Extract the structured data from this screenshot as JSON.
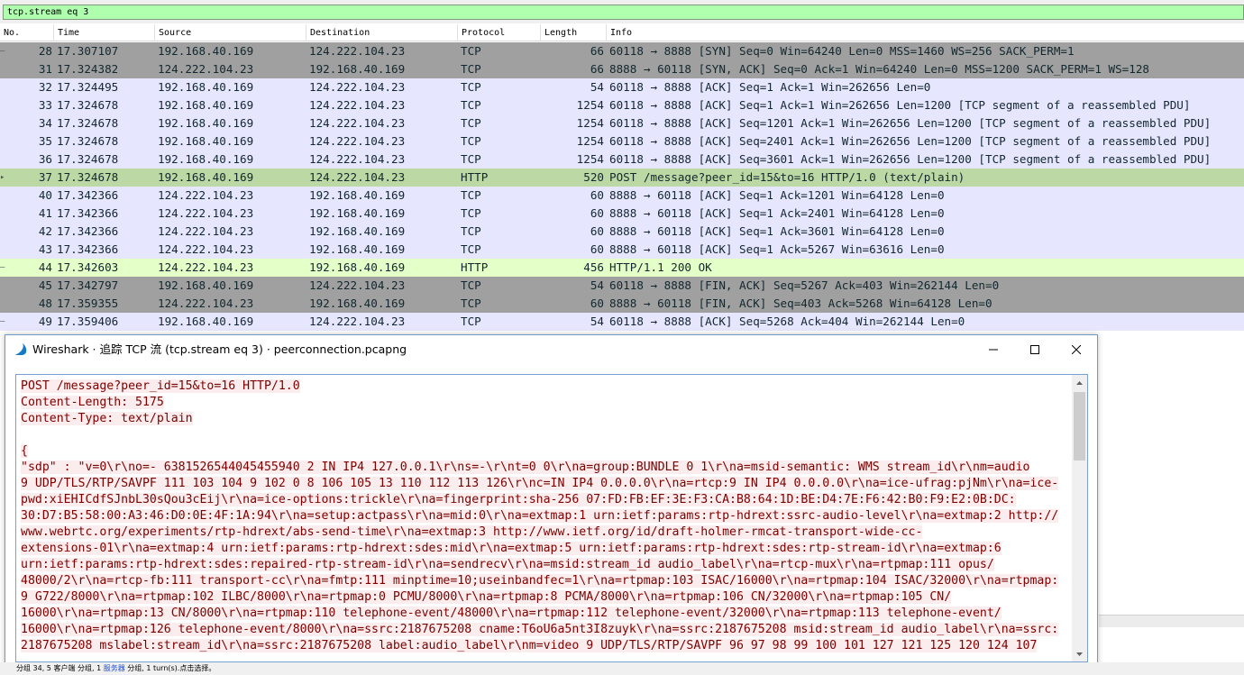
{
  "filter": {
    "text": "tcp.stream eq 3"
  },
  "columns": [
    "No.",
    "Time",
    "Source",
    "Destination",
    "Protocol",
    "Length",
    "Info"
  ],
  "packets": [
    {
      "no": "28",
      "time": "17.307107",
      "src": "192.168.40.169",
      "dst": "124.222.104.23",
      "proto": "TCP",
      "len": "66",
      "info": "60118 → 8888 [SYN] Seq=0 Win=64240 Len=0 MSS=1460 WS=256 SACK_PERM=1",
      "bg": "#a0a0a0",
      "mark": "–"
    },
    {
      "no": "31",
      "time": "17.324382",
      "src": "124.222.104.23",
      "dst": "192.168.40.169",
      "proto": "TCP",
      "len": "66",
      "info": "8888 → 60118 [SYN, ACK] Seq=0 Ack=1 Win=64240 Len=0 MSS=1200 SACK_PERM=1 WS=128",
      "bg": "#a0a0a0",
      "mark": ""
    },
    {
      "no": "32",
      "time": "17.324495",
      "src": "192.168.40.169",
      "dst": "124.222.104.23",
      "proto": "TCP",
      "len": "54",
      "info": "60118 → 8888 [ACK] Seq=1 Ack=1 Win=262656 Len=0",
      "bg": "#e7e6ff",
      "mark": ""
    },
    {
      "no": "33",
      "time": "17.324678",
      "src": "192.168.40.169",
      "dst": "124.222.104.23",
      "proto": "TCP",
      "len": "1254",
      "info": "60118 → 8888 [ACK] Seq=1 Ack=1 Win=262656 Len=1200 [TCP segment of a reassembled PDU]",
      "bg": "#e7e6ff",
      "mark": ""
    },
    {
      "no": "34",
      "time": "17.324678",
      "src": "192.168.40.169",
      "dst": "124.222.104.23",
      "proto": "TCP",
      "len": "1254",
      "info": "60118 → 8888 [ACK] Seq=1201 Ack=1 Win=262656 Len=1200 [TCP segment of a reassembled PDU]",
      "bg": "#e7e6ff",
      "mark": ""
    },
    {
      "no": "35",
      "time": "17.324678",
      "src": "192.168.40.169",
      "dst": "124.222.104.23",
      "proto": "TCP",
      "len": "1254",
      "info": "60118 → 8888 [ACK] Seq=2401 Ack=1 Win=262656 Len=1200 [TCP segment of a reassembled PDU]",
      "bg": "#e7e6ff",
      "mark": ""
    },
    {
      "no": "36",
      "time": "17.324678",
      "src": "192.168.40.169",
      "dst": "124.222.104.23",
      "proto": "TCP",
      "len": "1254",
      "info": "60118 → 8888 [ACK] Seq=3601 Ack=1 Win=262656 Len=1200 [TCP segment of a reassembled PDU]",
      "bg": "#e7e6ff",
      "mark": ""
    },
    {
      "no": "37",
      "time": "17.324678",
      "src": "192.168.40.169",
      "dst": "124.222.104.23",
      "proto": "HTTP",
      "len": "520",
      "info": "POST /message?peer_id=15&to=16 HTTP/1.0  (text/plain)",
      "bg": "#bcd8a4",
      "mark": "▸"
    },
    {
      "no": "40",
      "time": "17.342366",
      "src": "124.222.104.23",
      "dst": "192.168.40.169",
      "proto": "TCP",
      "len": "60",
      "info": "8888 → 60118 [ACK] Seq=1 Ack=1201 Win=64128 Len=0",
      "bg": "#e7e6ff",
      "mark": ""
    },
    {
      "no": "41",
      "time": "17.342366",
      "src": "124.222.104.23",
      "dst": "192.168.40.169",
      "proto": "TCP",
      "len": "60",
      "info": "8888 → 60118 [ACK] Seq=1 Ack=2401 Win=64128 Len=0",
      "bg": "#e7e6ff",
      "mark": ""
    },
    {
      "no": "42",
      "time": "17.342366",
      "src": "124.222.104.23",
      "dst": "192.168.40.169",
      "proto": "TCP",
      "len": "60",
      "info": "8888 → 60118 [ACK] Seq=1 Ack=3601 Win=64128 Len=0",
      "bg": "#e7e6ff",
      "mark": ""
    },
    {
      "no": "43",
      "time": "17.342366",
      "src": "124.222.104.23",
      "dst": "192.168.40.169",
      "proto": "TCP",
      "len": "60",
      "info": "8888 → 60118 [ACK] Seq=1 Ack=5267 Win=63616 Len=0",
      "bg": "#e7e6ff",
      "mark": ""
    },
    {
      "no": "44",
      "time": "17.342603",
      "src": "124.222.104.23",
      "dst": "192.168.40.169",
      "proto": "HTTP",
      "len": "456",
      "info": "HTTP/1.1 200 OK",
      "bg": "#e4ffc7",
      "mark": "–"
    },
    {
      "no": "45",
      "time": "17.342797",
      "src": "192.168.40.169",
      "dst": "124.222.104.23",
      "proto": "TCP",
      "len": "54",
      "info": "60118 → 8888 [FIN, ACK] Seq=5267 Ack=403 Win=262144 Len=0",
      "bg": "#a0a0a0",
      "mark": ""
    },
    {
      "no": "48",
      "time": "17.359355",
      "src": "124.222.104.23",
      "dst": "192.168.40.169",
      "proto": "TCP",
      "len": "60",
      "info": "8888 → 60118 [FIN, ACK] Seq=403 Ack=5268 Win=64128 Len=0",
      "bg": "#a0a0a0",
      "mark": ""
    },
    {
      "no": "49",
      "time": "17.359406",
      "src": "192.168.40.169",
      "dst": "124.222.104.23",
      "proto": "TCP",
      "len": "54",
      "info": "60118 → 8888 [ACK] Seq=5268 Ack=404 Win=262144 Len=0",
      "bg": "#e7e6ff",
      "mark": "–"
    }
  ],
  "dialog": {
    "title": "Wireshark · 追踪 TCP 流 (tcp.stream eq 3) · peerconnection.pcapng",
    "minimize_label": "–",
    "maximize_label": "☐",
    "close_label": "✕",
    "stream_lines": [
      "POST /message?peer_id=15&to=16 HTTP/1.0",
      "Content-Length: 5175",
      "Content-Type: text/plain",
      "",
      "{",
      "   \"sdp\" : \"v=0\\r\\no=- 6381526544045455940 2 IN IP4 127.0.0.1\\r\\ns=-\\r\\nt=0 0\\r\\na=group:BUNDLE 0 1\\r\\na=msid-semantic: WMS stream_id\\r\\nm=audio",
      "9 UDP/TLS/RTP/SAVPF 111 103 104 9 102 0 8 106 105 13 110 112 113 126\\r\\nc=IN IP4 0.0.0.0\\r\\na=rtcp:9 IN IP4 0.0.0.0\\r\\na=ice-ufrag:pjNm\\r\\na=ice-",
      "pwd:xiEHICdfSJnbL30sQou3cEij\\r\\na=ice-options:trickle\\r\\na=fingerprint:sha-256 07:FD:FB:EF:3E:F3:CA:B8:64:1D:BE:D4:7E:F6:42:B0:F9:E2:0B:DC:",
      "30:D7:B5:58:00:A3:46:D0:0E:4F:1A:94\\r\\na=setup:actpass\\r\\na=mid:0\\r\\na=extmap:1 urn:ietf:params:rtp-hdrext:ssrc-audio-level\\r\\na=extmap:2 http://",
      "www.webrtc.org/experiments/rtp-hdrext/abs-send-time\\r\\na=extmap:3 http://www.ietf.org/id/draft-holmer-rmcat-transport-wide-cc-",
      "extensions-01\\r\\na=extmap:4 urn:ietf:params:rtp-hdrext:sdes:mid\\r\\na=extmap:5 urn:ietf:params:rtp-hdrext:sdes:rtp-stream-id\\r\\na=extmap:6",
      "urn:ietf:params:rtp-hdrext:sdes:repaired-rtp-stream-id\\r\\na=sendrecv\\r\\na=msid:stream_id audio_label\\r\\na=rtcp-mux\\r\\na=rtpmap:111 opus/",
      "48000/2\\r\\na=rtcp-fb:111 transport-cc\\r\\na=fmtp:111 minptime=10;useinbandfec=1\\r\\na=rtpmap:103 ISAC/16000\\r\\na=rtpmap:104 ISAC/32000\\r\\na=rtpmap:",
      "9 G722/8000\\r\\na=rtpmap:102 ILBC/8000\\r\\na=rtpmap:0 PCMU/8000\\r\\na=rtpmap:8 PCMA/8000\\r\\na=rtpmap:106 CN/32000\\r\\na=rtpmap:105 CN/",
      "16000\\r\\na=rtpmap:13 CN/8000\\r\\na=rtpmap:110 telephone-event/48000\\r\\na=rtpmap:112 telephone-event/32000\\r\\na=rtpmap:113 telephone-event/",
      "16000\\r\\na=rtpmap:126 telephone-event/8000\\r\\na=ssrc:2187675208 cname:T6oU6a5nt3I8zuyk\\r\\na=ssrc:2187675208 msid:stream_id audio_label\\r\\na=ssrc:",
      "2187675208 mslabel:stream_id\\r\\na=ssrc:2187675208 label:audio_label\\r\\nm=video 9 UDP/TLS/RTP/SAVPF 96 97 98 99 100 101 127 121 125 120 124 107"
    ]
  },
  "status": {
    "text_a": "分组 34, 5 客户端 分组, 1 ",
    "link": "服务器",
    "text_b": " 分组, 1 turn(s).点击选择。"
  },
  "colors": {
    "tcp_bad": "#a0a0a0",
    "tcp": "#e7e6ff",
    "http_selected": "#bcd8a4",
    "http": "#e4ffc7",
    "client_text": "#7d0000",
    "client_bg": "#fbeded",
    "filter_ok": "#afffaf"
  }
}
